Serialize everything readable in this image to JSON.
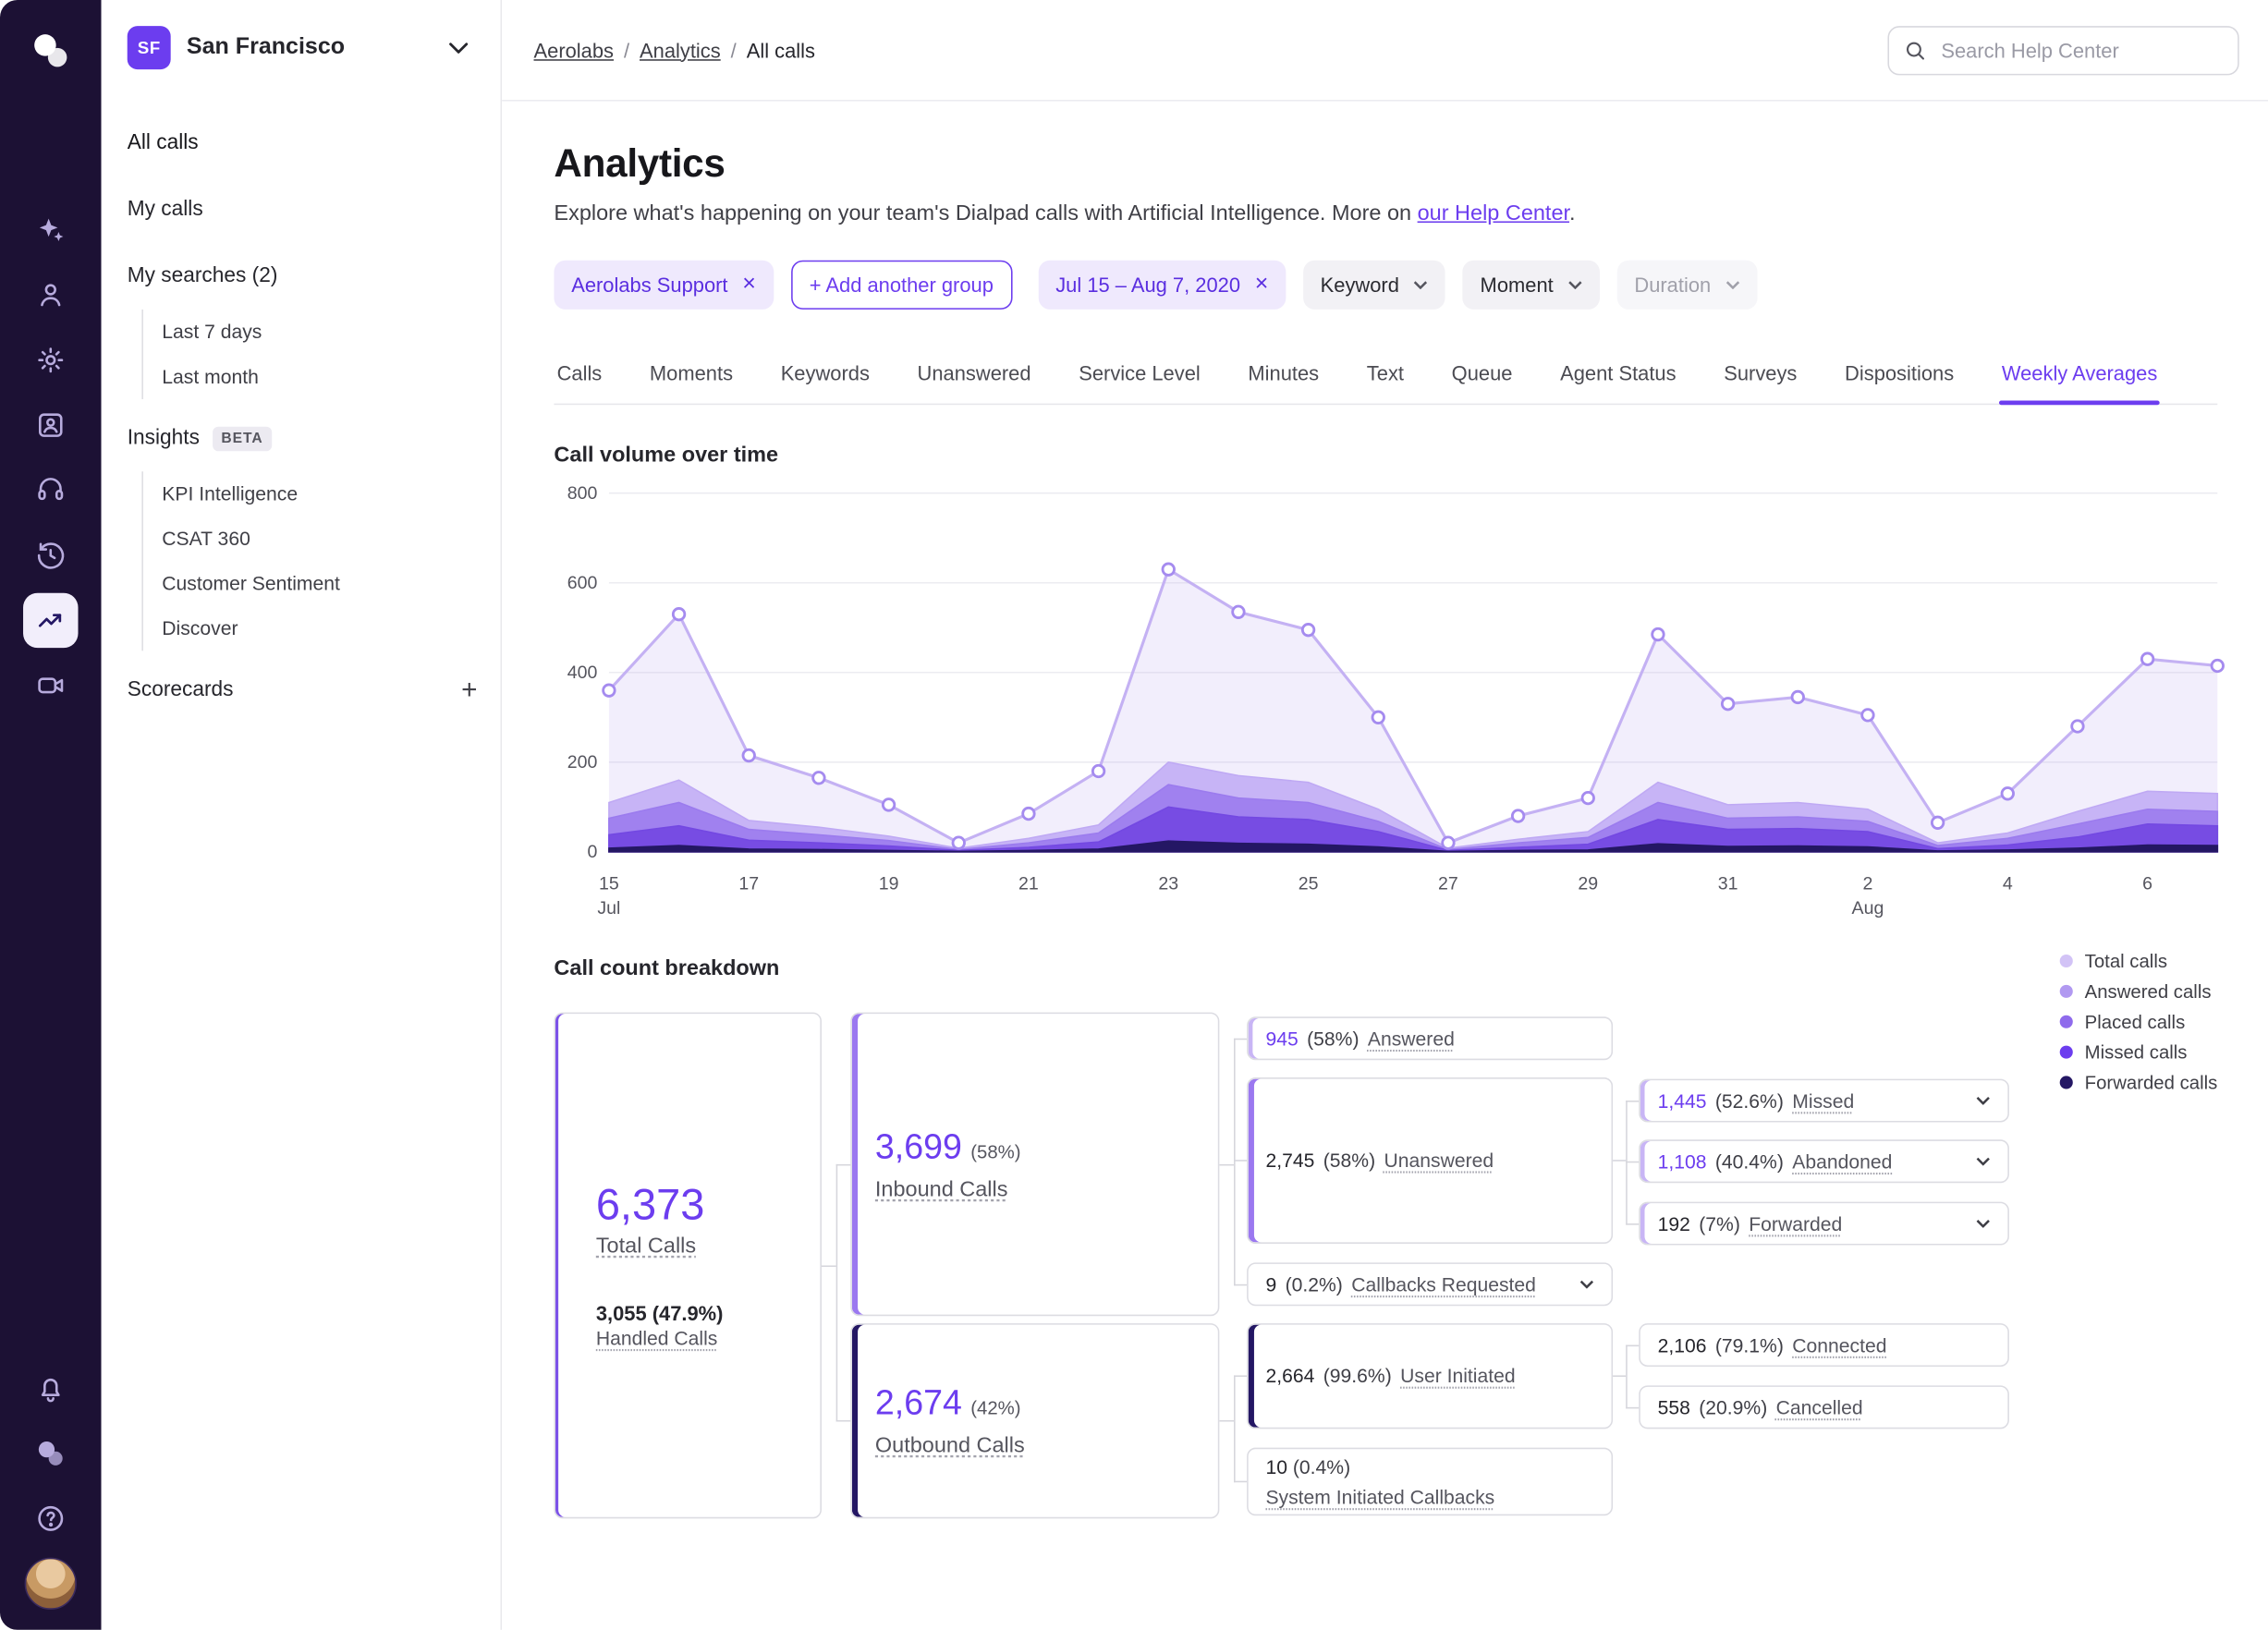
{
  "colors": {
    "accent": "#6C3DEF",
    "rail_bg": "#1C1134",
    "chip_purple_bg": "#EFE9FD",
    "border": "#DCDCE2"
  },
  "rail": {
    "icons": [
      "dialpad-logo",
      "ai-sparkles",
      "person",
      "settings-gear",
      "contact-card",
      "headset",
      "history",
      "analytics-trend",
      "video-meetings",
      "bell",
      "dialpad-mark",
      "help",
      "user-avatar"
    ]
  },
  "workspace": {
    "badge": "SF",
    "name": "San Francisco"
  },
  "sidebar": {
    "all_calls": "All calls",
    "my_calls": "My calls",
    "my_searches": "My searches (2)",
    "searches": [
      "Last 7 days",
      "Last month"
    ],
    "insights_label": "Insights",
    "beta_label": "BETA",
    "insights_items": [
      "KPI Intelligence",
      "CSAT 360",
      "Customer Sentiment",
      "Discover"
    ],
    "scorecards_label": "Scorecards",
    "add_label": "+"
  },
  "header": {
    "breadcrumb": [
      "Aerolabs",
      "Analytics",
      "All calls"
    ],
    "separator": "/",
    "search_placeholder": "Search Help Center"
  },
  "page": {
    "title": "Analytics",
    "description_prefix": "Explore what's happening on your team's Dialpad calls with Artificial Intelligence. More on ",
    "description_link": "our Help Center",
    "description_suffix": "."
  },
  "filters": {
    "group_chip": "Aerolabs Support",
    "close_glyph": "×",
    "add_group": "+ Add another group",
    "date_chip": "Jul 15 – Aug 7, 2020",
    "keyword": "Keyword",
    "moment": "Moment",
    "duration": "Duration"
  },
  "tabs": {
    "items": [
      "Calls",
      "Moments",
      "Keywords",
      "Unanswered",
      "Service Level",
      "Minutes",
      "Text",
      "Queue",
      "Agent Status",
      "Surveys",
      "Dispositions",
      "Weekly Averages"
    ],
    "active": "Weekly Averages"
  },
  "chart_data": {
    "type": "area",
    "title": "Call volume over time",
    "ylim": [
      0,
      800
    ],
    "yticks": [
      0,
      200,
      400,
      600,
      800
    ],
    "marker_color": "#A58BEF",
    "x": [
      "Jul 15",
      "Jul 16",
      "Jul 17",
      "Jul 18",
      "Jul 19",
      "Jul 20",
      "Jul 21",
      "Jul 22",
      "Jul 23",
      "Jul 24",
      "Jul 25",
      "Jul 26",
      "Jul 27",
      "Jul 28",
      "Jul 29",
      "Jul 30",
      "Jul 31",
      "Aug 1",
      "Aug 2",
      "Aug 3",
      "Aug 4",
      "Aug 5",
      "Aug 6",
      "Aug 7"
    ],
    "xticks": [
      {
        "label": "15",
        "sub": "Jul",
        "day": 0
      },
      {
        "label": "17",
        "day": 2
      },
      {
        "label": "19",
        "day": 4
      },
      {
        "label": "21",
        "day": 6
      },
      {
        "label": "23",
        "day": 8
      },
      {
        "label": "25",
        "day": 10
      },
      {
        "label": "27",
        "day": 12
      },
      {
        "label": "29",
        "day": 14
      },
      {
        "label": "31",
        "day": 16
      },
      {
        "label": "2",
        "sub": "Aug",
        "day": 18
      },
      {
        "label": "4",
        "day": 20
      },
      {
        "label": "6",
        "day": 22
      }
    ],
    "series": [
      {
        "name": "Total calls",
        "color": "#C4B1F3",
        "values": [
          360,
          530,
          215,
          165,
          105,
          20,
          85,
          180,
          630,
          535,
          495,
          300,
          20,
          80,
          120,
          485,
          330,
          345,
          305,
          65,
          130,
          280,
          430,
          415
        ]
      },
      {
        "name": "Answered calls",
        "color": "#BFA9F4",
        "values": [
          110,
          160,
          70,
          55,
          35,
          8,
          30,
          60,
          200,
          170,
          155,
          95,
          8,
          28,
          45,
          155,
          105,
          110,
          95,
          20,
          42,
          90,
          135,
          130
        ]
      },
      {
        "name": "Placed calls",
        "color": "#9B7BEE",
        "values": [
          75,
          110,
          50,
          38,
          25,
          5,
          20,
          42,
          150,
          120,
          110,
          68,
          5,
          20,
          32,
          110,
          75,
          78,
          68,
          14,
          30,
          62,
          95,
          90
        ]
      },
      {
        "name": "Missed calls",
        "color": "#7348E2",
        "values": [
          38,
          58,
          26,
          20,
          13,
          3,
          10,
          22,
          100,
          78,
          72,
          45,
          3,
          10,
          17,
          72,
          50,
          52,
          45,
          7,
          15,
          33,
          62,
          58
        ]
      },
      {
        "name": "Forwarded calls",
        "color": "#241764",
        "values": [
          8,
          14,
          6,
          5,
          3,
          1,
          3,
          6,
          24,
          19,
          17,
          11,
          1,
          3,
          4,
          18,
          12,
          13,
          11,
          2,
          4,
          8,
          15,
          14
        ]
      }
    ],
    "legend_position": "right"
  },
  "legend": {
    "items": [
      {
        "label": "Total calls",
        "color": "#D2C3F6"
      },
      {
        "label": "Answered calls",
        "color": "#B199F1"
      },
      {
        "label": "Placed calls",
        "color": "#8F6BEC"
      },
      {
        "label": "Missed calls",
        "color": "#6C3DEF"
      },
      {
        "label": "Forwarded calls",
        "color": "#241764"
      }
    ]
  },
  "breakdown": {
    "title": "Call count breakdown",
    "total": {
      "value": "6,373",
      "label": "Total Calls",
      "sub_value": "3,055 (47.9%)",
      "sub_label": "Handled Calls"
    },
    "inbound": {
      "value": "3,699",
      "pct": "(58%)",
      "label": "Inbound Calls"
    },
    "outbound": {
      "value": "2,674",
      "pct": "(42%)",
      "label": "Outbound Calls"
    },
    "answered": {
      "value": "945",
      "pct": "(58%)",
      "label": "Answered"
    },
    "unanswered": {
      "value": "2,745",
      "pct": "(58%)",
      "label": "Unanswered"
    },
    "callbacks": {
      "value": "9",
      "pct": "(0.2%)",
      "label": "Callbacks Requested"
    },
    "missed": {
      "value": "1,445",
      "pct": "(52.6%)",
      "label": "Missed"
    },
    "abandoned": {
      "value": "1,108",
      "pct": "(40.4%)",
      "label": "Abandoned"
    },
    "forwarded": {
      "value": "192",
      "pct": "(7%)",
      "label": "Forwarded"
    },
    "user_initiated": {
      "value": "2,664",
      "pct": "(99.6%)",
      "label": "User Initiated"
    },
    "system_initiated": {
      "value": "10",
      "pct": "(0.4%)",
      "label": "System Initiated Callbacks"
    },
    "connected": {
      "value": "2,106",
      "pct": "(79.1%)",
      "label": "Connected"
    },
    "cancelled": {
      "value": "558",
      "pct": "(20.9%)",
      "label": "Cancelled"
    }
  }
}
